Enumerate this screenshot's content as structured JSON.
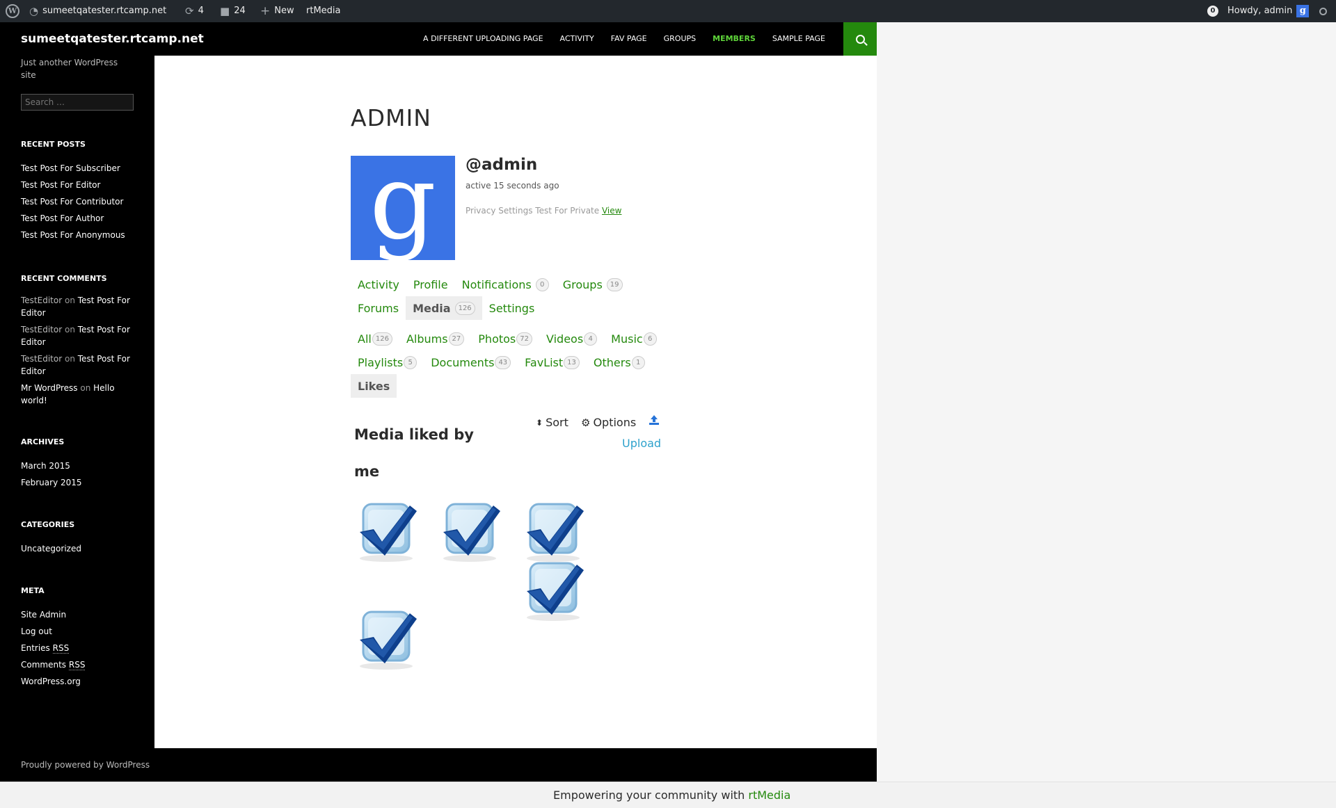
{
  "adminbar": {
    "site": "sumeetqatester.rtcamp.net",
    "updates": "4",
    "comments": "24",
    "new_label": "New",
    "plugin": "rtMedia",
    "notifications": "0",
    "greeting": "Howdy, admin"
  },
  "header": {
    "site_title": "sumeetqatester.rtcamp.net",
    "nav": [
      {
        "label": "A Different Uploading Page"
      },
      {
        "label": "Activity"
      },
      {
        "label": "Fav Page"
      },
      {
        "label": "Groups"
      },
      {
        "label": "Members",
        "active": true
      },
      {
        "label": "Sample Page"
      }
    ]
  },
  "sidebar": {
    "tagline": "Just another WordPress site",
    "search_placeholder": "Search …",
    "recent_posts": {
      "title": "Recent Posts",
      "items": [
        "Test Post For Subscriber",
        "Test Post For Editor",
        "Test Post For Contributor",
        "Test Post For Author",
        "Test Post For Anonymous"
      ]
    },
    "recent_comments": {
      "title": "Recent Comments",
      "on": "on",
      "items": [
        {
          "author": "TestEditor",
          "post": "Test Post For Editor"
        },
        {
          "author": "TestEditor",
          "post": "Test Post For Editor"
        },
        {
          "author": "TestEditor",
          "post": "Test Post For Editor"
        },
        {
          "author": "Mr WordPress",
          "post": "Hello world!"
        }
      ]
    },
    "archives": {
      "title": "Archives",
      "items": [
        "March 2015",
        "February 2015"
      ]
    },
    "categories": {
      "title": "Categories",
      "items": [
        "Uncategorized"
      ]
    },
    "meta": {
      "title": "Meta",
      "items": [
        "Site Admin",
        "Log out"
      ],
      "entries": "Entries",
      "comments": "Comments",
      "rss": "RSS",
      "wordpress_org": "WordPress.org"
    }
  },
  "profile": {
    "title": "ADMIN",
    "handle": "@admin",
    "activity": "active 15 seconds ago",
    "privacy_text": "Privacy Settings Test For Private",
    "privacy_link": "View",
    "avatar_letter": "g"
  },
  "nav_tabs": [
    {
      "label": "Activity",
      "count": null
    },
    {
      "label": "Profile",
      "count": null
    },
    {
      "label": "Notifications",
      "count": "0"
    },
    {
      "label": "Groups",
      "count": "19"
    },
    {
      "label": "Forums",
      "count": null
    },
    {
      "label": "Media",
      "count": "126",
      "current": true
    },
    {
      "label": "Settings",
      "count": null
    }
  ],
  "media_tabs": [
    {
      "label": "All",
      "count": "126"
    },
    {
      "label": "Albums",
      "count": "27"
    },
    {
      "label": "Photos",
      "count": "72"
    },
    {
      "label": "Videos",
      "count": "4"
    },
    {
      "label": "Music",
      "count": "6"
    },
    {
      "label": "Playlists",
      "count": "5"
    },
    {
      "label": "Documents",
      "count": "43"
    },
    {
      "label": "FavList",
      "count": "13"
    },
    {
      "label": "Others",
      "count": "1"
    },
    {
      "label": "Likes",
      "count": null,
      "current": true
    }
  ],
  "gallery": {
    "heading": "Media liked by me",
    "sort_label": "Sort",
    "options_label": "Options",
    "upload_label": "Upload",
    "item_count": 5
  },
  "footer": {
    "credit": "Proudly powered by WordPress",
    "rtmedia_prefix": "Empowering your community with",
    "rtmedia_link": "rtMedia"
  },
  "colors": {
    "accent": "#24890d",
    "nav_active": "#5fd53a",
    "upload_blue": "#2ea2cc",
    "avatar_blue": "#3a73e5"
  }
}
